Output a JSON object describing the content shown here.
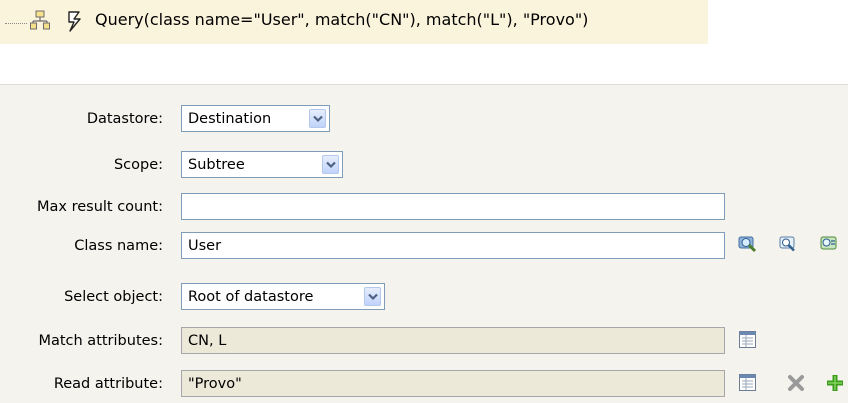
{
  "expression": {
    "text": "Query(class name=\"User\", match(\"CN\"), match(\"L\"), \"Provo\")",
    "icons": [
      "tree-node-icon",
      "token-lightning-icon"
    ]
  },
  "form": {
    "datastore": {
      "label": "Datastore:",
      "value": "Destination"
    },
    "scope": {
      "label": "Scope:",
      "value": "Subtree"
    },
    "max_result_count": {
      "label": "Max result count:",
      "value": ""
    },
    "class_name": {
      "label": "Class name:",
      "value": "User",
      "icons": [
        "browse-schema-icon",
        "browse-object-icon",
        "browse-list-icon"
      ]
    },
    "select_object": {
      "label": "Select object:",
      "value": "Root of datastore"
    },
    "match_attributes": {
      "label": "Match attributes:",
      "value": "CN, L",
      "icons": [
        "edit-list-icon"
      ]
    },
    "read_attribute": {
      "label": "Read attribute:",
      "value": "\"Provo\"",
      "icons": [
        "edit-list-icon",
        "delete-icon",
        "add-icon"
      ]
    }
  },
  "colors": {
    "tree_highlight": "#fbf4dc",
    "panel_background": "#f5f3ee",
    "readonly_field": "#ece9d8",
    "field_border": "#7f9db9",
    "add_green": "#3d9c1e",
    "delete_gray": "#9a9a9a"
  }
}
